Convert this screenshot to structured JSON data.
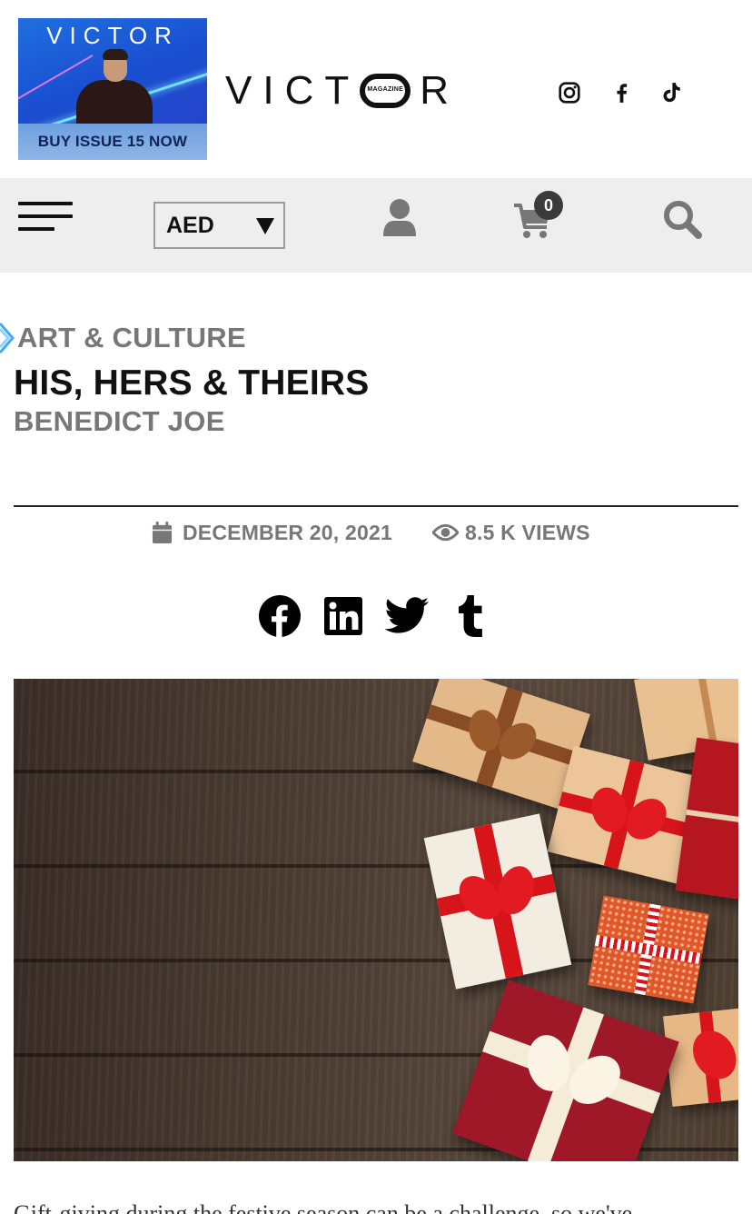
{
  "header": {
    "ad": {
      "logo_text": "VICTOR",
      "cta": "BUY ISSUE 15 NOW"
    },
    "brand": {
      "name_left": "VICT",
      "name_right": "R",
      "o_caption": "MAGAZINE"
    },
    "social": [
      "instagram-icon",
      "facebook-icon",
      "tiktok-icon"
    ]
  },
  "nav": {
    "currency": "AED",
    "cart_count": "0",
    "icons": [
      "menu-icon",
      "user-icon",
      "cart-icon",
      "search-icon"
    ]
  },
  "article": {
    "category": "ART & CULTURE",
    "title": "HIS, HERS & THEIRS",
    "author": "BENEDICT JOE",
    "date": "DECEMBER 20, 2021",
    "views": "8.5 K VIEWS",
    "share": [
      "facebook-icon",
      "linkedin-icon",
      "twitter-icon",
      "tumblr-icon"
    ],
    "body_peek": "Gift-giving during the festive season can be a challenge, so we've"
  },
  "colors": {
    "navbar_bg": "#eeeeee",
    "muted_text": "#777777",
    "accent_chevron": "#3fa9f5",
    "cart_badge": "#3b3b3b"
  }
}
